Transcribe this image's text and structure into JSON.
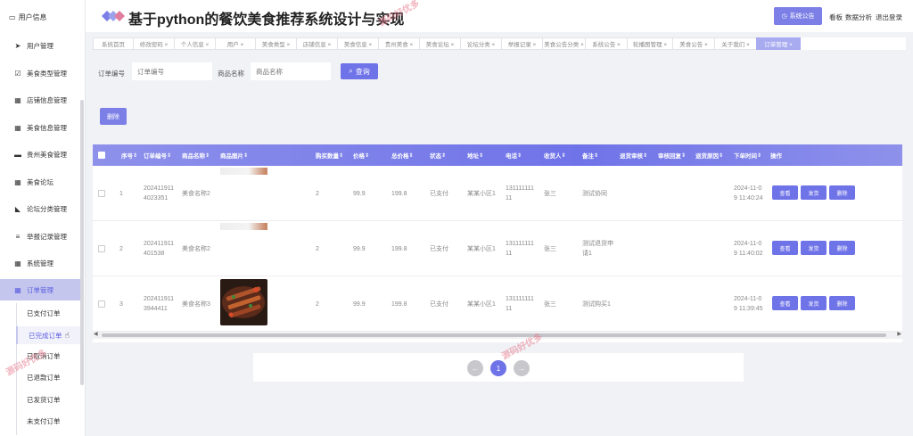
{
  "app": {
    "title": "基于python的餐饮美食推荐系统设计与实现"
  },
  "header": {
    "notice_label": "系统公告",
    "links": [
      "看板",
      "数据分析",
      "退出登录"
    ]
  },
  "sidebar": {
    "user_label": "用户信息",
    "items": [
      {
        "label": "用户管理",
        "icon": "send-icon"
      },
      {
        "label": "美食类型管理",
        "icon": "checkbox-icon"
      },
      {
        "label": "店铺信息管理",
        "icon": "grid-icon"
      },
      {
        "label": "美食信息管理",
        "icon": "grid-icon"
      },
      {
        "label": "贵州美食管理",
        "icon": "chat-icon"
      },
      {
        "label": "美食论坛",
        "icon": "grid-icon"
      },
      {
        "label": "论坛分类管理",
        "icon": "thumb-icon"
      },
      {
        "label": "举报记录管理",
        "icon": "list-icon"
      },
      {
        "label": "系统管理",
        "icon": "grid-icon"
      },
      {
        "label": "订单管理",
        "icon": "grid-icon"
      }
    ],
    "subitems": [
      "已支付订单",
      "已完成订单",
      "已取消订单",
      "已退款订单",
      "已发货订单",
      "未支付订单"
    ]
  },
  "tabs": [
    {
      "label": "系统首页"
    },
    {
      "label": "修改密码 ×"
    },
    {
      "label": "个人信息 ×"
    },
    {
      "label": "用户 ×"
    },
    {
      "label": "美食类型 ×"
    },
    {
      "label": "店铺信息 ×"
    },
    {
      "label": "美食信息 ×"
    },
    {
      "label": "贵州美食 ×"
    },
    {
      "label": "美食论坛 ×"
    },
    {
      "label": "论坛分类 ×"
    },
    {
      "label": "举报记录 ×"
    },
    {
      "label": "美食公告分类 ×"
    },
    {
      "label": "系统公告 ×"
    },
    {
      "label": "轮播图管理 ×"
    },
    {
      "label": "美食公告 ×"
    },
    {
      "label": "关于我们 ×"
    },
    {
      "label": "订单管理 ×"
    }
  ],
  "search": {
    "order_no_label": "订单编号",
    "order_no_placeholder": "订单编号",
    "product_label": "商品名称",
    "product_placeholder": "商品名称",
    "query_label": "查询",
    "delete_label": "删除"
  },
  "table": {
    "headers": [
      "序号",
      "订单编号",
      "商品名称",
      "商品图片",
      "购买数量",
      "价格",
      "总价格",
      "状态",
      "地址",
      "电话",
      "收货人",
      "备注",
      "退货审核",
      "审核回复",
      "退货原因",
      "下单时间",
      "操作"
    ],
    "rows": [
      {
        "idx": "1",
        "order_no": [
          "202411911",
          "4023351"
        ],
        "product": "美食名称2",
        "qty": "2",
        "price": "99.9",
        "total": "199.8",
        "status": "已支付",
        "address": "某某小区1",
        "phone": [
          "131111111",
          "11"
        ],
        "receiver": "张三",
        "remark": [
          "测试协同"
        ],
        "time": [
          "2024-11-0",
          "9 11:40:24"
        ]
      },
      {
        "idx": "2",
        "order_no": [
          "202411911",
          "401538"
        ],
        "product": "美食名称2",
        "qty": "2",
        "price": "99.9",
        "total": "199.8",
        "status": "已支付",
        "address": "某某小区1",
        "phone": [
          "131111111",
          "11"
        ],
        "receiver": "张三",
        "remark": [
          "测试退货申",
          "请1"
        ],
        "time": [
          "2024-11-0",
          "9 11:40:02"
        ]
      },
      {
        "idx": "3",
        "order_no": [
          "202411911",
          "3944411"
        ],
        "product": "美食名称3",
        "qty": "2",
        "price": "99.9",
        "total": "199.8",
        "status": "已支付",
        "address": "某某小区1",
        "phone": [
          "131111111",
          "11"
        ],
        "receiver": "张三",
        "remark": [
          "测试购买1"
        ],
        "time": [
          "2024-11-0",
          "9 11:39:45"
        ]
      }
    ],
    "actions": [
      "查看",
      "发货",
      "删除"
    ]
  },
  "pagination": {
    "prev": "←",
    "current": "1",
    "next": "→"
  },
  "watermark": "源码好优多",
  "colors": {
    "accent": "#6f73e8",
    "sidebar_active": "#c4c6ee"
  }
}
